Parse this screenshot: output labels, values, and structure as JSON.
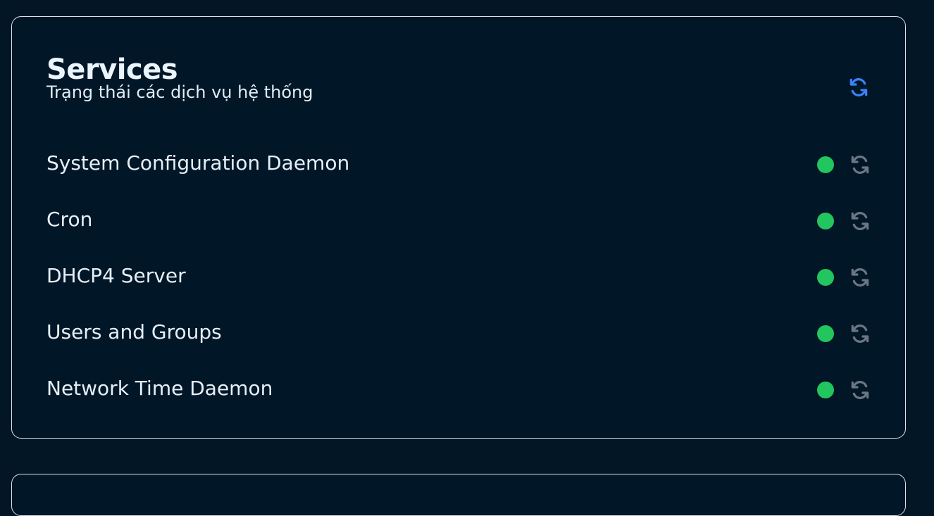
{
  "card": {
    "title": "Services",
    "subtitle": "Trạng thái các dịch vụ hệ thống",
    "refresh_icon": "refresh-icon",
    "accent_color": "#3b82f6"
  },
  "services": [
    {
      "name": "System Configuration Daemon",
      "status": "running",
      "status_color": "#22c55e",
      "action_icon": "restart-icon"
    },
    {
      "name": "Cron",
      "status": "running",
      "status_color": "#22c55e",
      "action_icon": "restart-icon"
    },
    {
      "name": "DHCP4 Server",
      "status": "running",
      "status_color": "#22c55e",
      "action_icon": "restart-icon"
    },
    {
      "name": "Users and Groups",
      "status": "running",
      "status_color": "#22c55e",
      "action_icon": "restart-icon"
    },
    {
      "name": "Network Time Daemon",
      "status": "running",
      "status_color": "#22c55e",
      "action_icon": "restart-icon"
    }
  ]
}
